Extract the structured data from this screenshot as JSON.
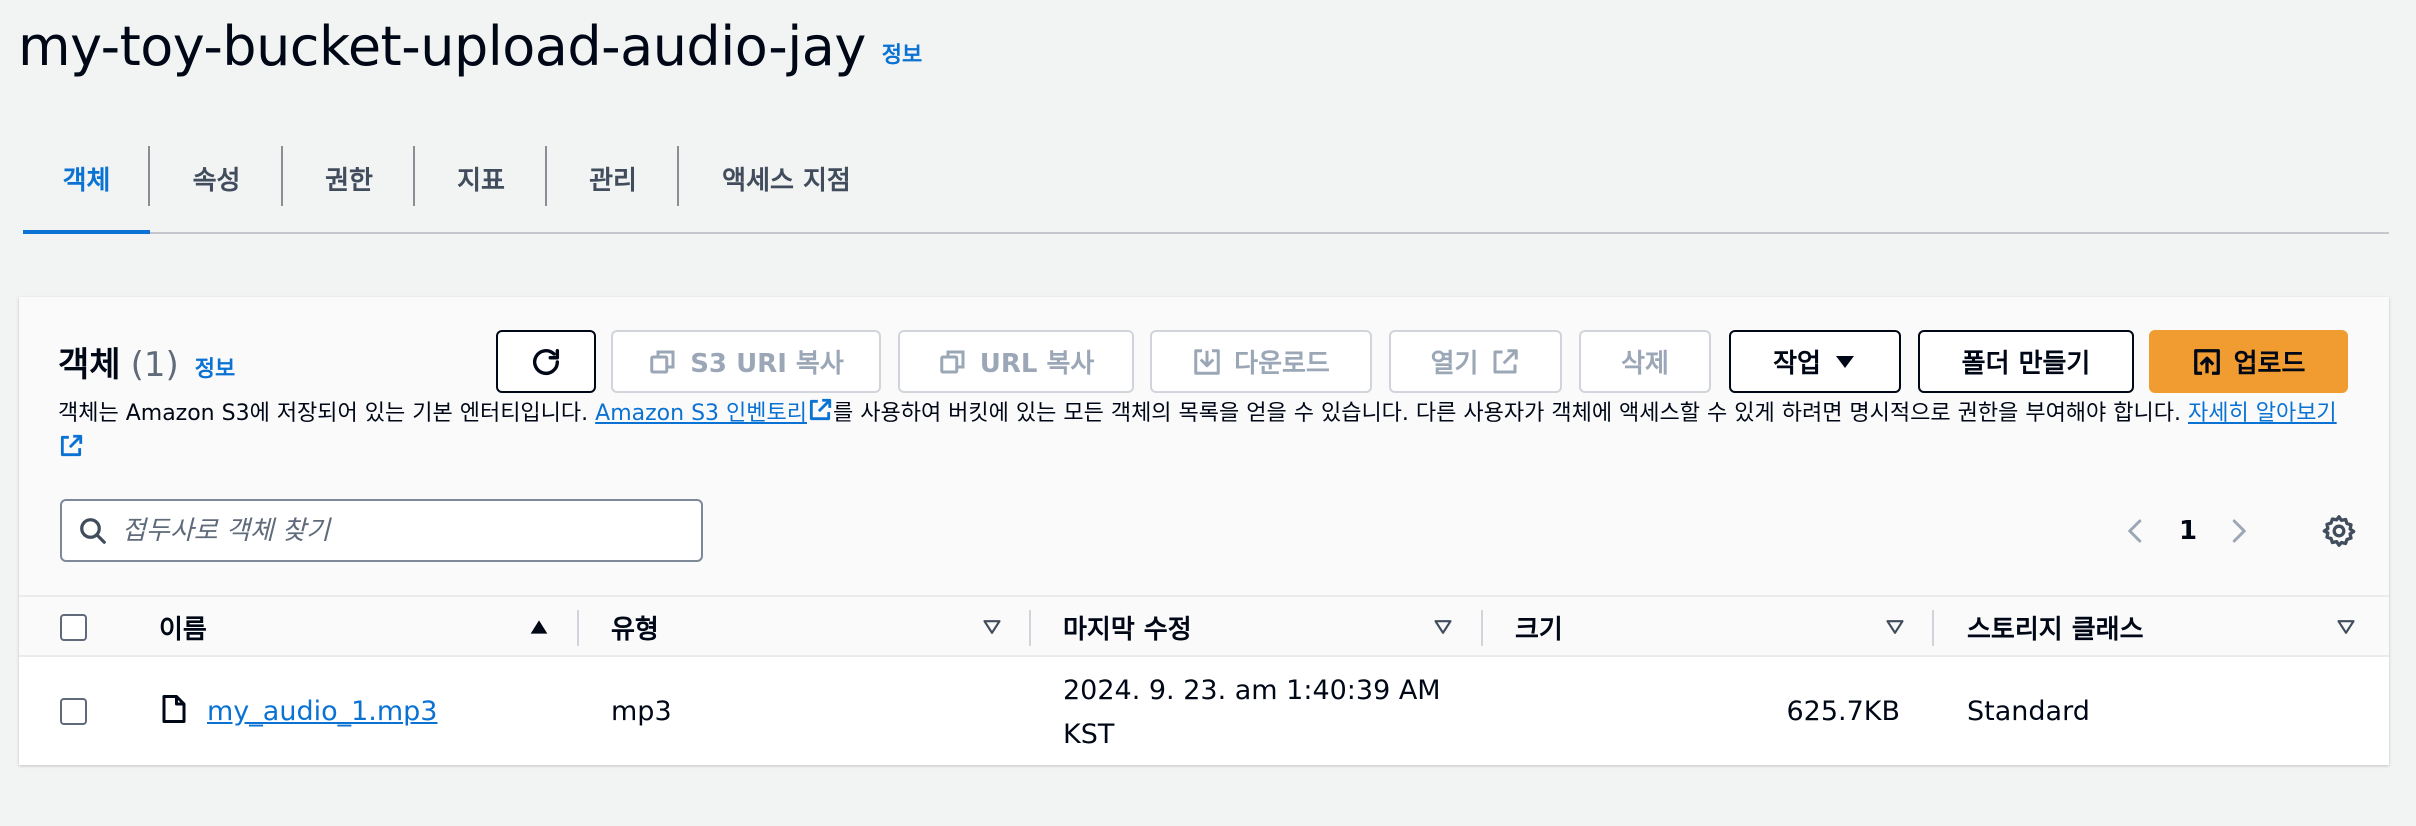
{
  "header": {
    "title": "my-toy-bucket-upload-audio-jay",
    "info_label": "정보"
  },
  "tabs": [
    {
      "label": "객체",
      "active": true
    },
    {
      "label": "속성"
    },
    {
      "label": "권한"
    },
    {
      "label": "지표"
    },
    {
      "label": "관리"
    },
    {
      "label": "액세스 지점"
    }
  ],
  "objects": {
    "title": "객체",
    "count": "(1)",
    "info_label": "정보",
    "buttons": {
      "refresh": "refresh",
      "copy_s3_uri": "S3 URI 복사",
      "copy_url": "URL 복사",
      "download": "다운로드",
      "open": "열기",
      "delete": "삭제",
      "actions": "작업",
      "create_folder": "폴더 만들기",
      "upload": "업로드"
    },
    "description": {
      "part1": "객체는 Amazon S3에 저장되어 있는 기본 엔터티입니다. ",
      "inventory_link": "Amazon S3 인벤토리",
      "part2": "를 사용하여 버킷에 있는 모든 객체의 목록을 얻을 수 있습니다. 다른 사용자가 객체에 액세스할 수 있게 하려면 명시적으로 권한을 부여해야 합니다. ",
      "learn_more_link": "자세히 알아보기"
    },
    "search": {
      "placeholder": "접두사로 객체 찾기",
      "value": ""
    },
    "pagination": {
      "current_page": "1"
    },
    "table": {
      "columns": [
        "이름",
        "유형",
        "마지막 수정",
        "크기",
        "스토리지 클래스"
      ],
      "rows": [
        {
          "name": "my_audio_1.mp3",
          "type": "mp3",
          "last_modified": "2024. 9. 23. am 1:40:39 AM KST",
          "size": "625.7KB",
          "storage_class": "Standard"
        }
      ]
    }
  },
  "colors": {
    "accent": "#0972d3",
    "primary_button": "#f09c31",
    "background": "#f2f3f3"
  }
}
